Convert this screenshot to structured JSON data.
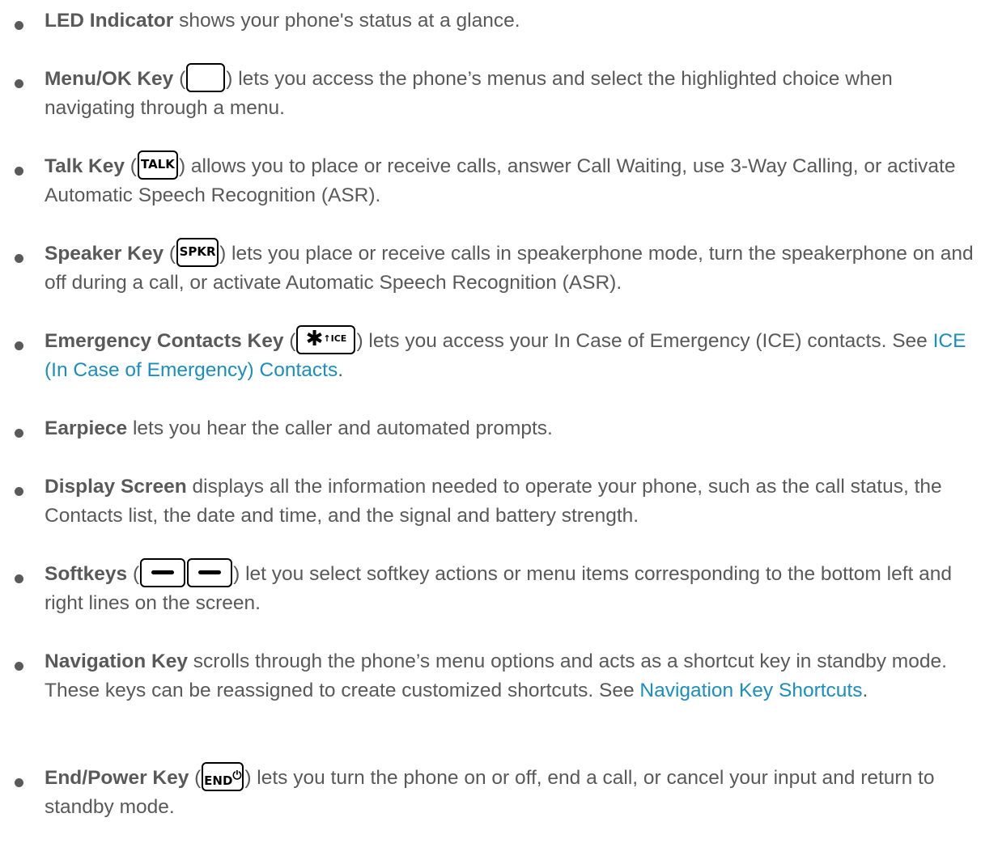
{
  "items": [
    {
      "term": "LED Indicator",
      "text": " shows your phone's status at a glance."
    },
    {
      "term": "Menu/OK Key",
      "open": " (",
      "close": ") lets you access the phone’s menus and select the highlighted choice when navigating through a menu.",
      "key_icon": "blank-key-icon"
    },
    {
      "term": "Talk Key",
      "open": " (",
      "key_label": "TALK",
      "close": ") allows you to place or receive calls, answer Call Waiting, use 3-Way Calling, or activate Automatic Speech Recognition (ASR)."
    },
    {
      "term": "Speaker Key",
      "open": " (",
      "key_label": "SPKR",
      "close": ") lets you place or receive calls in speakerphone mode, turn the speakerphone on and off during a call, or activate Automatic Speech Recognition (ASR)."
    },
    {
      "term": "Emergency Contacts Key",
      "open": " (",
      "key_star": "✱",
      "key_label": "↑ICE",
      "close": ") lets you access your In Case of Emergency (ICE) contacts. See ",
      "link": "ICE (In Case of Emergency) Contacts",
      "after_link": "."
    },
    {
      "term": "Earpiece",
      "text": " lets you hear the caller and automated prompts."
    },
    {
      "term": "Display Screen",
      "text": " displays all the information needed to operate your phone, such as the call status, the Contacts list, the date and time, and the signal and battery strength."
    },
    {
      "term": "Softkeys",
      "open": " (",
      "close": ") let you select softkey actions or menu items corresponding to the bottom left and right lines on the screen.",
      "key_icon": "softkey-icon"
    },
    {
      "term": "Navigation Key",
      "text": " scrolls through the phone’s menu options and acts as a shortcut key in standby mode. These keys can be reassigned to create customized shortcuts. See ",
      "link": "Navigation Key Shortcuts",
      "after_link": "."
    },
    {
      "term": "End/Power Key",
      "open": " (",
      "key_label": "END",
      "key_sup": "⏻",
      "close": ") lets you turn the phone on or off, end a call, or cancel your input and return to standby mode."
    }
  ],
  "colors": {
    "text": "#595959",
    "link": "#1a8fbf",
    "bullet": "#5a5a5a"
  }
}
